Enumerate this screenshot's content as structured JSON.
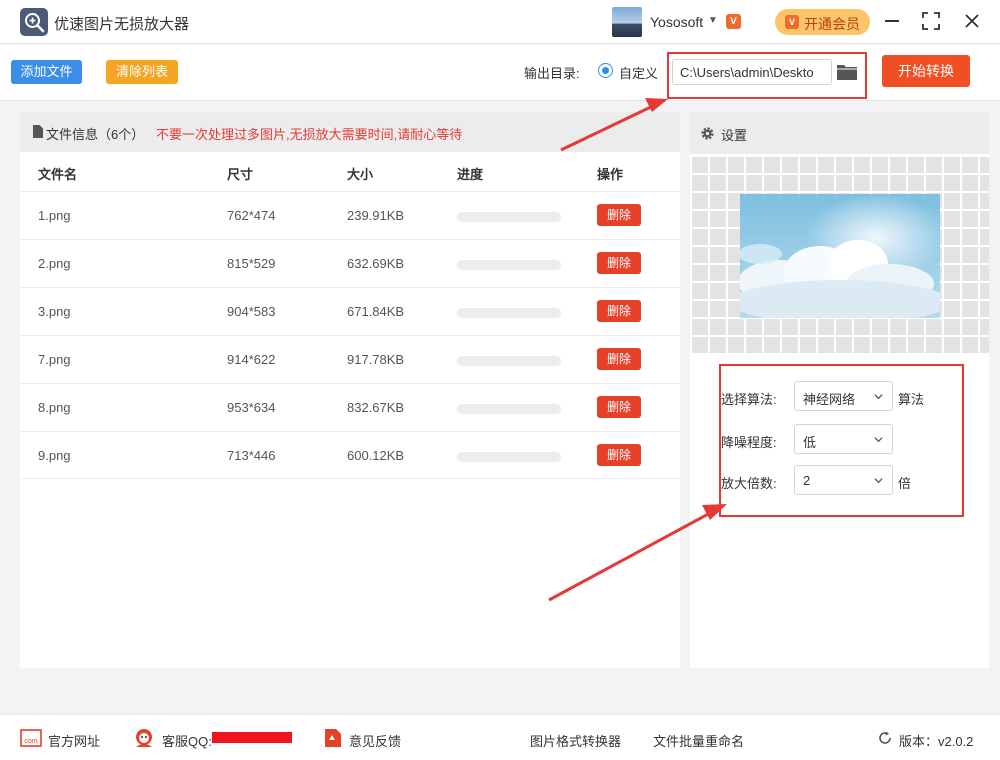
{
  "app": {
    "title": "优速图片无损放大器",
    "username": "Yososoft",
    "vip_label": "开通会员"
  },
  "toolbar": {
    "add_label": "添加文件",
    "clear_label": "清除列表",
    "output_label": "输出目录:",
    "radio_label": "自定义",
    "path_value": "C:\\Users\\admin\\Deskto",
    "start_label": "开始转换"
  },
  "files": {
    "header_title": "文件信息（6个）",
    "header_warning": "不要一次处理过多图片,无损放大需要时间,请耐心等待",
    "columns": [
      "文件名",
      "尺寸",
      "大小",
      "进度",
      "操作"
    ],
    "rows": [
      {
        "name": "1.png",
        "dims": "762*474",
        "size": "239.91KB",
        "progress": 0,
        "action": "删除"
      },
      {
        "name": "2.png",
        "dims": "815*529",
        "size": "632.69KB",
        "progress": 0,
        "action": "删除"
      },
      {
        "name": "3.png",
        "dims": "904*583",
        "size": "671.84KB",
        "progress": 0,
        "action": "删除"
      },
      {
        "name": "7.png",
        "dims": "914*622",
        "size": "917.78KB",
        "progress": 0,
        "action": "删除"
      },
      {
        "name": "8.png",
        "dims": "953*634",
        "size": "832.67KB",
        "progress": 0,
        "action": "删除"
      },
      {
        "name": "9.png",
        "dims": "713*446",
        "size": "600.12KB",
        "progress": 0,
        "action": "删除"
      }
    ]
  },
  "settings": {
    "title": "设置",
    "algorithm_label": "选择算法:",
    "algorithm_value": "神经网络",
    "algorithm_suffix": "算法",
    "denoise_label": "降噪程度:",
    "denoise_value": "低",
    "scale_label": "放大倍数:",
    "scale_value": "2",
    "scale_suffix": "倍"
  },
  "footer": {
    "website": "官方网址",
    "qq": "客服QQ:",
    "feedback": "意见反馈",
    "format_converter": "图片格式转换器",
    "batch_rename": "文件批量重命名",
    "version": "版本：v2.0.2"
  },
  "colors": {
    "primary_blue": "#3a8ee6",
    "orange": "#f5a524",
    "start_red": "#f04e23",
    "delete_red": "#e5412a",
    "warning_red": "#e53935",
    "vip_gold": "#fbc66a"
  },
  "icons": [
    "app-logo-icon",
    "chevron-down-icon",
    "vip-icon",
    "minimize-icon",
    "maximize-icon",
    "close-icon",
    "folder-icon",
    "document-icon",
    "gear-icon",
    "website-icon",
    "qq-icon",
    "feedback-icon",
    "refresh-icon"
  ]
}
